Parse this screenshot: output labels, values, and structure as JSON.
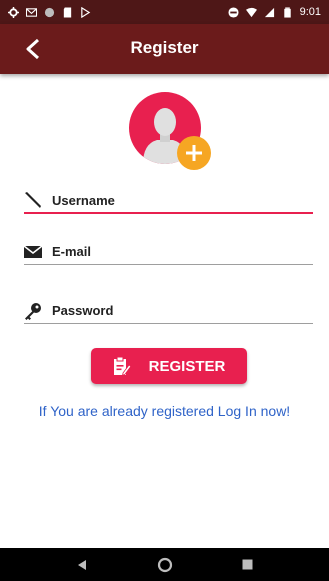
{
  "status_bar": {
    "time": "9:01",
    "left_icons": [
      "settings-icon",
      "gmail-icon",
      "circle-icon",
      "sd-card-icon",
      "play-store-icon"
    ],
    "right_icons": [
      "dnd-icon",
      "wifi-icon",
      "signal-icon",
      "battery-icon"
    ]
  },
  "app_bar": {
    "title": "Register",
    "back_icon": "back-arrow-icon"
  },
  "avatar": {
    "icon": "user-avatar-icon",
    "add_icon": "plus-icon"
  },
  "form": {
    "username": {
      "placeholder": "Username",
      "value": "",
      "icon": "pencil-icon"
    },
    "email": {
      "placeholder": "E-mail",
      "value": "",
      "icon": "mail-icon"
    },
    "password": {
      "placeholder": "Password",
      "value": "",
      "icon": "key-icon"
    }
  },
  "register_button": {
    "label": "REGISTER",
    "icon": "clipboard-edit-icon"
  },
  "login_link": {
    "text": "If You are already registered Log In now!"
  },
  "nav_bar": {
    "items": [
      "back-triangle-icon",
      "home-circle-icon",
      "recents-square-icon"
    ]
  },
  "colors": {
    "status_bar": "#4e1717",
    "app_bar": "#6b1b1b",
    "accent": "#e8204f",
    "add_badge": "#f6a623",
    "link": "#2f63c8"
  }
}
